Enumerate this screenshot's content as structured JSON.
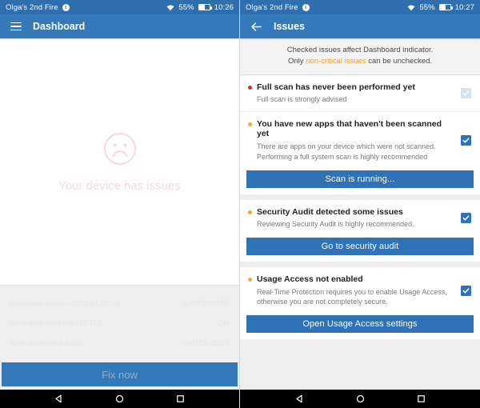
{
  "left": {
    "statusbar": {
      "device_name": "Olga's 2nd Fire",
      "notification_icon": "info-icon",
      "wifi_icon": "wifi-icon",
      "battery_text": "55%",
      "battery_icon": "battery-icon",
      "time": "10:26"
    },
    "appbar": {
      "menu_icon": "hamburger-menu-icon",
      "title": "Dashboard"
    },
    "hero": {
      "face_icon": "sad-face-icon",
      "status_text": "Your device has issues"
    },
    "info_rows": [
      {
        "key": "Database version 2017.01.09.01",
        "value": "UP TO DATE"
      },
      {
        "key": "Real-time protection (RTP)",
        "value": "ON"
      },
      {
        "key": "Next scheduled scan",
        "value": "JAN 11, 2017"
      }
    ],
    "fix_button": "Fix now"
  },
  "right": {
    "statusbar": {
      "device_name": "Olga's 2nd Fire",
      "notification_icon": "info-icon",
      "wifi_icon": "wifi-icon",
      "battery_text": "55%",
      "battery_icon": "battery-icon",
      "time": "10:27"
    },
    "appbar": {
      "back_icon": "back-arrow-icon",
      "title": "Issues"
    },
    "notice": {
      "line1": "Checked issues affect Dashboard indicator.",
      "line2_prefix": "Only ",
      "line2_highlight": "non-critical issues",
      "line2_suffix": " can be unchecked."
    },
    "cards": [
      {
        "issues": [
          {
            "severity": "critical",
            "title": "Full scan has never been performed yet",
            "desc": "Full scan is strongly advised",
            "checkbox": {
              "checked": true,
              "enabled": false
            }
          },
          {
            "severity": "minor",
            "title": "You have new apps that haven't been scanned yet",
            "desc": "There are apps on your device which were not scanned. Performing a full system scan is highly recommended",
            "checkbox": {
              "checked": true,
              "enabled": true
            }
          }
        ],
        "action": "Scan is running..."
      },
      {
        "issues": [
          {
            "severity": "minor",
            "title": "Security Audit detected some issues",
            "desc": "Reviewing Security Audit is highly recommended.",
            "checkbox": {
              "checked": true,
              "enabled": true
            }
          }
        ],
        "action": "Go to security audit"
      },
      {
        "issues": [
          {
            "severity": "minor",
            "title": "Usage Access not enabled",
            "desc": "Real-Time Protection requires you to enable Usage Access, otherwise you are not completely secure.",
            "checkbox": {
              "checked": true,
              "enabled": true
            }
          }
        ],
        "action": "Open Usage Access settings"
      }
    ]
  },
  "navbar": {
    "back_icon": "nav-back-triangle-icon",
    "home_icon": "nav-home-circle-icon",
    "recents_icon": "nav-recents-square-icon"
  },
  "colors": {
    "statusbar": "#2f6fae",
    "appbar": "#3479b8",
    "accent": "#2f72b5",
    "critical": "#cf2f34",
    "minor": "#e3b23c",
    "warn_text": "#e8a33d",
    "page_bg": "#eeeeee"
  }
}
